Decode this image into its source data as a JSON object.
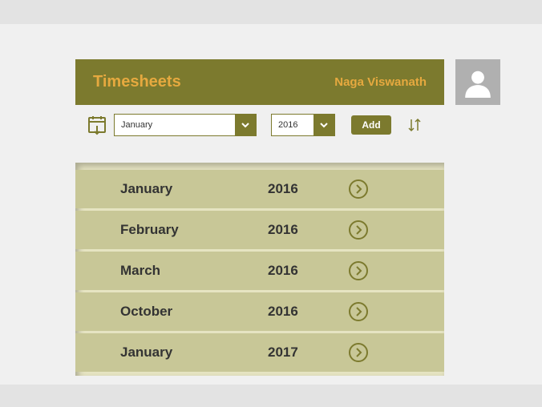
{
  "header": {
    "title": "Timesheets",
    "username": "Naga Viswanath"
  },
  "controls": {
    "month_selected": "January",
    "year_selected": "2016",
    "add_label": "Add"
  },
  "colors": {
    "olive": "#7c7a2e",
    "gold": "#e6a93f"
  },
  "timesheets": [
    {
      "month": "January",
      "year": "2016"
    },
    {
      "month": "February",
      "year": "2016"
    },
    {
      "month": "March",
      "year": "2016"
    },
    {
      "month": "October",
      "year": "2016"
    },
    {
      "month": "January",
      "year": "2017"
    }
  ]
}
